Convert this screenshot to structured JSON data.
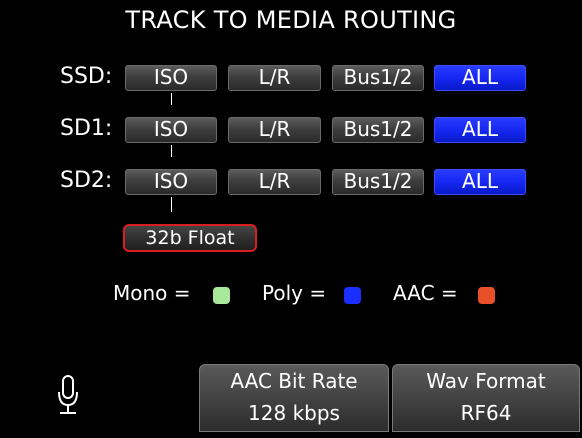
{
  "title": "TRACK TO MEDIA ROUTING",
  "rows": [
    {
      "label": "SSD:",
      "iso": "ISO",
      "lr": "L/R",
      "bus": "Bus1/2",
      "all": "ALL"
    },
    {
      "label": "SD1:",
      "iso": "ISO",
      "lr": "L/R",
      "bus": "Bus1/2",
      "all": "ALL"
    },
    {
      "label": "SD2:",
      "iso": "ISO",
      "lr": "L/R",
      "bus": "Bus1/2",
      "all": "ALL"
    }
  ],
  "float_button": "32b Float",
  "legend": {
    "mono_label": "Mono =",
    "poly_label": "Poly =",
    "aac_label": "AAC =",
    "mono_color": "#a8e89a",
    "poly_color": "#1a2eff",
    "aac_color": "#e8502a"
  },
  "colors": {
    "active_button": "#1426f0",
    "float_border": "#d81e1e"
  },
  "bottom_buttons": {
    "aac_bit_rate": {
      "label": "AAC Bit Rate",
      "value": "128 kbps"
    },
    "wav_format": {
      "label": "Wav Format",
      "value": "RF64"
    }
  },
  "icons": {
    "mic": "microphone-icon"
  }
}
